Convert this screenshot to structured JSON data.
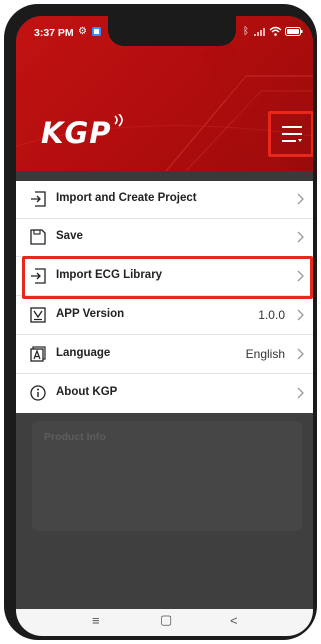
{
  "status_bar": {
    "time": "3:37 PM",
    "icons": [
      "gear-icon",
      "app-icon",
      "bluetooth-icon",
      "signal-icon",
      "wifi-icon",
      "battery-icon"
    ]
  },
  "header": {
    "logo_text": "KGP",
    "menu_icon": "hamburger-menu-icon",
    "accent_color": "#c21212",
    "highlight_color": "#e8281a"
  },
  "menu": {
    "items": [
      {
        "label": "Import and Create Project",
        "value": "",
        "icon": "import-arrow-icon"
      },
      {
        "label": "Save",
        "value": "",
        "icon": "save-icon"
      },
      {
        "label": "Import ECG Library",
        "value": "",
        "icon": "import-arrow-icon"
      },
      {
        "label": "APP Version",
        "value": "1.0.0",
        "icon": "version-icon"
      },
      {
        "label": "Language",
        "value": "English",
        "icon": "language-icon"
      },
      {
        "label": "About KGP",
        "value": "",
        "icon": "info-icon"
      }
    ]
  },
  "background_card": {
    "title": "Product Info"
  },
  "nav_bar": {
    "menu_glyph": "≡",
    "home_glyph": "▢",
    "back_glyph": "<"
  }
}
